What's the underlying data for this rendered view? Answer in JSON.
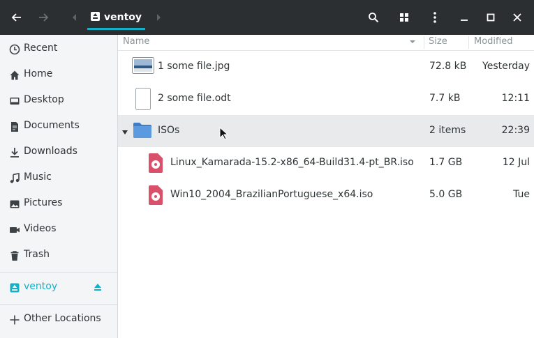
{
  "header": {
    "path_label": "ventoy",
    "icons": [
      "back-icon",
      "forward-icon",
      "path-left-icon",
      "drive-icon",
      "path-right-icon",
      "search-icon",
      "view-grid-icon",
      "menu-dots-icon",
      "minimize-icon",
      "maximize-icon",
      "close-icon"
    ]
  },
  "sidebar": {
    "items": [
      {
        "label": "Recent",
        "icon": "clock-icon"
      },
      {
        "label": "Home",
        "icon": "home-icon"
      },
      {
        "label": "Desktop",
        "icon": "desktop-icon"
      },
      {
        "label": "Documents",
        "icon": "document-icon"
      },
      {
        "label": "Downloads",
        "icon": "download-icon"
      },
      {
        "label": "Music",
        "icon": "music-icon"
      },
      {
        "label": "Pictures",
        "icon": "picture-icon"
      },
      {
        "label": "Videos",
        "icon": "video-icon"
      },
      {
        "label": "Trash",
        "icon": "trash-icon"
      }
    ],
    "device": {
      "label": "ventoy",
      "icon": "drive-icon",
      "action_icon": "eject-icon",
      "color": "#13b1c7"
    },
    "other": {
      "label": "Other Locations",
      "icon": "plus-icon"
    }
  },
  "columns": {
    "name": "Name",
    "size": "Size",
    "modified": "Modified"
  },
  "files": [
    {
      "name": "1 some file.jpg",
      "size": "72.8 kB",
      "modified": "Yesterday",
      "icon": "image-file-icon"
    },
    {
      "name": "2 some file.odt",
      "size": "7.7 kB",
      "modified": "12:11",
      "icon": "document-file-icon"
    },
    {
      "name": "ISOs",
      "size": "2 items",
      "modified": "22:39",
      "icon": "folder-icon",
      "expanded": true
    },
    {
      "name": "Linux_Kamarada-15.2-x86_64-Build31.4-pt_BR.iso",
      "size": "1.7 GB",
      "modified": "12 Jul",
      "icon": "disc-image-icon"
    },
    {
      "name": "Win10_2004_BrazilianPortuguese_x64.iso",
      "size": "5.0 GB",
      "modified": "Tue",
      "icon": "disc-image-icon"
    }
  ],
  "colors": {
    "accent": "#13b1c7",
    "header_bg": "#2b2f31",
    "sidebar_bg": "#f4f5f6",
    "selection_bg": "#e8eaeb"
  }
}
